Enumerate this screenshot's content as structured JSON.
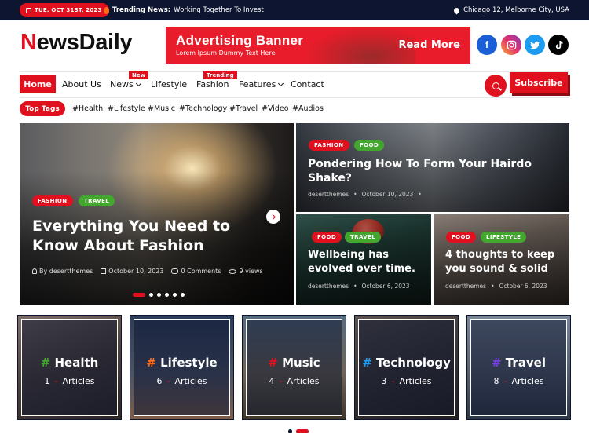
{
  "topbar": {
    "date": "TUE. OCT 31ST, 2023",
    "trending_label": "Trending News:",
    "trending_text": "Working Together To Invest",
    "location": "Chicago 12, Melborne City, USA"
  },
  "header": {
    "logo_accent": "N",
    "logo_rest": "ewsDaily",
    "ad_title": "Advertising Banner",
    "ad_sub": "Lorem Ipsum Dummy Text Here.",
    "ad_cta": "Read More",
    "social": [
      "facebook-icon",
      "instagram-icon",
      "twitter-icon",
      "tiktok-icon"
    ]
  },
  "nav": {
    "items": [
      "Home",
      "About Us",
      "News",
      "Lifestyle",
      "Fashion",
      "Features",
      "Contact"
    ],
    "badge_news": "New",
    "badge_fashion": "Trending",
    "subscribe": "Subscribe"
  },
  "tags": {
    "label": "Top Tags",
    "items": [
      "#Health",
      "#Lifestyle",
      "#Music",
      "#Technology",
      "#Travel",
      "#Video",
      "#Audios"
    ]
  },
  "featured": {
    "main": {
      "cats": [
        "FASHION",
        "TRAVEL"
      ],
      "title": "Everything You Need to Know About Fashion",
      "author": "By desertthemes",
      "date": "October 10, 2023",
      "comments": "0 Comments",
      "views": "9 views"
    },
    "top": {
      "cats": [
        "FASHION",
        "FOOD"
      ],
      "title": "Pondering How To Form Your Hairdo Shake?",
      "author": "desertthemes",
      "date": "October 10, 2023"
    },
    "small1": {
      "cats": [
        "FOOD",
        "TRAVEL"
      ],
      "title": "Wellbeing has evolved over time.",
      "author": "desertthemes",
      "date": "October 6, 2023"
    },
    "small2": {
      "cats": [
        "FOOD",
        "LIFESTYLE"
      ],
      "title": "4 thoughts to keep you sound & solid",
      "author": "desertthemes",
      "date": "October 6, 2023"
    }
  },
  "categories": [
    {
      "name": "Health",
      "count": "1",
      "label": "Articles",
      "hash_color": "#43a72f"
    },
    {
      "name": "Lifestyle",
      "count": "6",
      "label": "Articles",
      "hash_color": "#ff6a1a"
    },
    {
      "name": "Music",
      "count": "4",
      "label": "Articles",
      "hash_color": "#e0101e"
    },
    {
      "name": "Technology",
      "count": "3",
      "label": "Articles",
      "hash_color": "#1d9bf0"
    },
    {
      "name": "Travel",
      "count": "8",
      "label": "Articles",
      "hash_color": "#7a3fe0"
    }
  ],
  "colors": {
    "accent": "#e0101e",
    "dark": "#0e1530",
    "green": "#43a72f"
  }
}
